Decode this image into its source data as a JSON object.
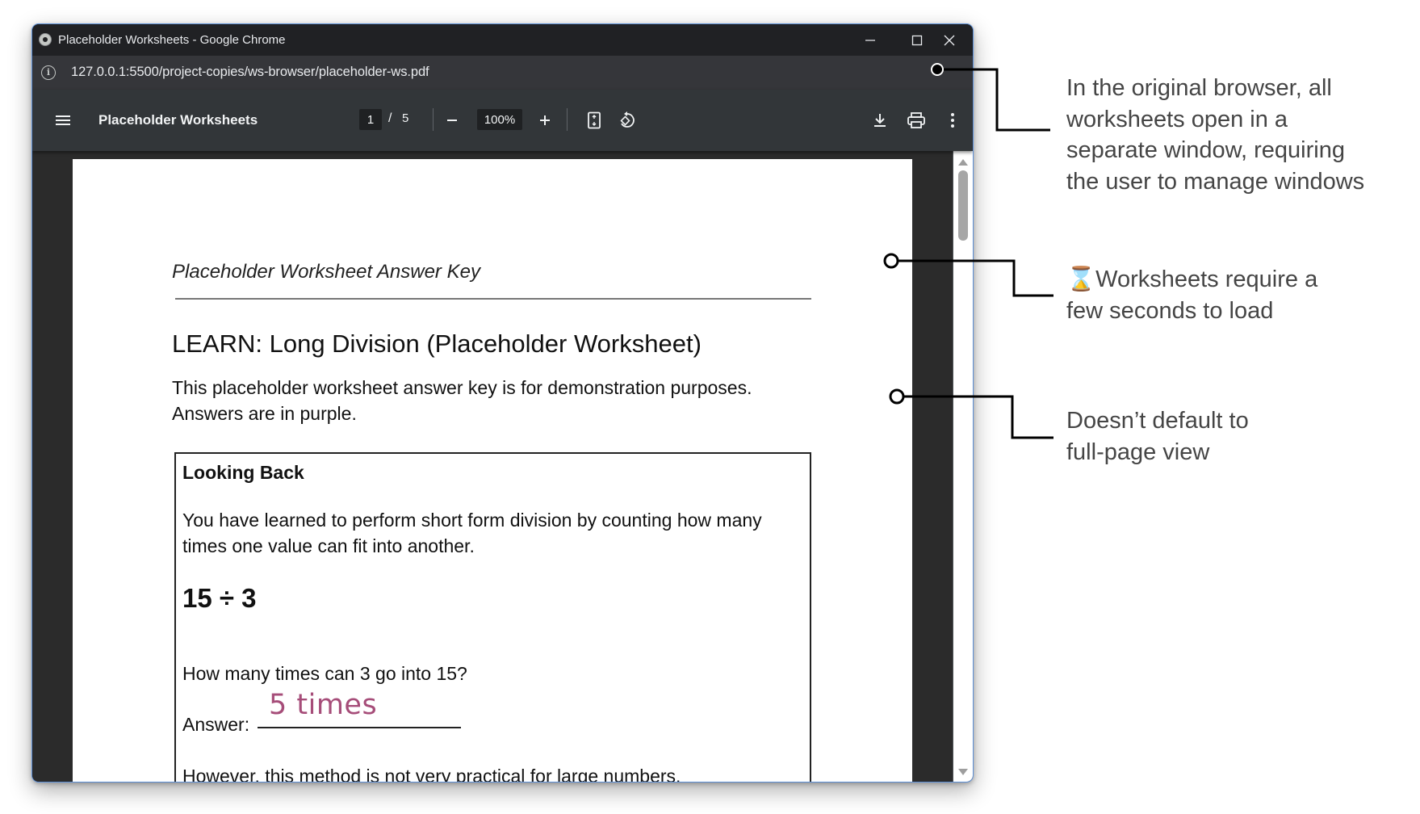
{
  "window": {
    "title": "Placeholder Worksheets - Google Chrome",
    "url": "127.0.0.1:5500/project-copies/ws-browser/placeholder-ws.pdf"
  },
  "pdf_toolbar": {
    "document_title": "Placeholder Worksheets",
    "current_page": "1",
    "page_separator": "/",
    "total_pages": "5",
    "zoom": "100%"
  },
  "page": {
    "answer_key_title": "Placeholder Worksheet Answer Key",
    "heading": "LEARN: Long Division (Placeholder Worksheet)",
    "intro_line_1": "This placeholder worksheet answer key is for demonstration purposes.",
    "intro_line_2": "Answers are in purple.",
    "box": {
      "heading": "Looking Back",
      "paragraph_line_1": "You have learned to perform short form division by counting how many",
      "paragraph_line_2": "times one value can fit into another.",
      "equation": "15 ÷ 3",
      "question": "How many times can 3 go into 15?",
      "answer_label": "Answer:",
      "answer_value": "5 times",
      "answer_color": "#a64d79",
      "trailing_text": "However, this method is not very practical for large numbers."
    }
  },
  "annotations": {
    "note_1": [
      "In the original browser, all",
      "worksheets open in a",
      "separate window, requiring",
      "the user to manage windows"
    ],
    "note_2_icon": "⌛",
    "note_2": [
      "Worksheets require a",
      "few seconds to load"
    ],
    "note_3": [
      "Doesn’t default to",
      "full-page view"
    ]
  },
  "icons": {
    "window_icon": "chrome-icon",
    "site_info": "info-icon",
    "menu": "hamburger-icon",
    "zoom_out": "minus-icon",
    "zoom_in": "plus-icon",
    "fit_page": "fit-to-page-icon",
    "rotate": "rotate-icon",
    "download": "download-icon",
    "print": "print-icon",
    "more": "more-vert-icon",
    "minimize": "minimize-icon",
    "maximize": "maximize-icon",
    "close": "close-icon"
  }
}
